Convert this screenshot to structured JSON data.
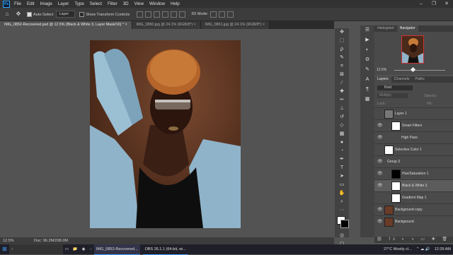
{
  "menu": [
    "File",
    "Edit",
    "Image",
    "Layer",
    "Type",
    "Select",
    "Filter",
    "3D",
    "View",
    "Window",
    "Help"
  ],
  "window_controls": [
    "–",
    "❐",
    "✕"
  ],
  "options": {
    "auto_select_label": "Auto-Select",
    "auto_select_value": "Layer",
    "transform_label": "Show Transform Controls",
    "mode_3d_label": "3D Mode:"
  },
  "tabs": [
    {
      "label": "IMG_0852-Recovered.psd @ 12.5% (Black & White 3, Layer Mask/16) *  ×"
    },
    {
      "label": "IMG_0850.jpg @ 24.1% (RGB/8*)  ×"
    },
    {
      "label": "IMG_0861.jpg @ 24.1% (RGB/8*)  ×"
    }
  ],
  "status": {
    "zoom": "12.5%",
    "doc": "Doc: 96.2M/298.0M"
  },
  "navigator": {
    "tabs": [
      "Histogram",
      "Navigator"
    ],
    "zoom": "12.5%"
  },
  "layers_panel": {
    "tabs": [
      "Layers",
      "Channels",
      "Paths"
    ],
    "kind": "Kind",
    "blend": "Multiply",
    "opacity_label": "Opacity:",
    "fill_label": "Fill:",
    "lock_label": "Lock:",
    "layers": [
      {
        "name": "Layer 1",
        "indent": 0,
        "visible": false,
        "thumb": "#777"
      },
      {
        "name": "Smart Filters",
        "indent": 1,
        "visible": true,
        "thumb": "#fff"
      },
      {
        "name": "High Pass",
        "indent": 2,
        "visible": true,
        "thumb": ""
      },
      {
        "name": "Selective Color 1",
        "indent": 0,
        "visible": false,
        "thumb": "#fff"
      },
      {
        "name": "Group 3",
        "indent": 0,
        "visible": true,
        "thumb": ""
      },
      {
        "name": "Hue/Saturation 1",
        "indent": 1,
        "visible": true,
        "thumb": "#000"
      },
      {
        "name": "Black & White 3",
        "indent": 1,
        "visible": true,
        "thumb": "#fff"
      },
      {
        "name": "Gradient Map 1",
        "indent": 1,
        "visible": false,
        "thumb": "#fff"
      },
      {
        "name": "Background copy",
        "indent": 0,
        "visible": true,
        "thumb": "#6a3c28"
      },
      {
        "name": "Background",
        "indent": 0,
        "visible": true,
        "thumb": "#6a3c28"
      }
    ]
  },
  "taskbar": {
    "apps": [
      "IMG_0852-Recovered...",
      "OBS 26.1.1 (64-bit, wi..."
    ],
    "weather": "27°C  Mostly cl...",
    "time": "12:39 AM"
  }
}
